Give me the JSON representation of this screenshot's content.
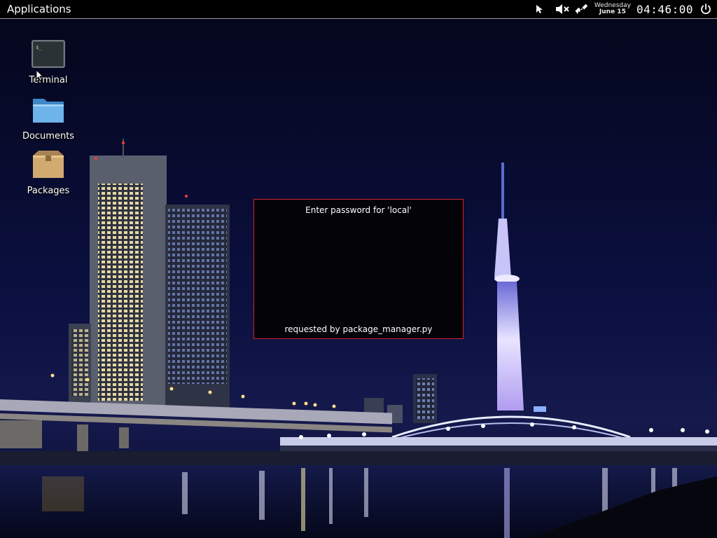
{
  "panel": {
    "applications_label": "Applications",
    "date_weekday": "Wednesday",
    "date_day": "June 15",
    "clock": "04:46:00",
    "tray_icons": [
      "pointer-icon",
      "volume-muted-icon",
      "network-disconnected-icon",
      "power-icon"
    ]
  },
  "desktop": {
    "icons": [
      {
        "label": "Terminal",
        "icon": "terminal-icon"
      },
      {
        "label": "Documents",
        "icon": "folder-icon"
      },
      {
        "label": "Packages",
        "icon": "package-box-icon"
      }
    ]
  },
  "dialog": {
    "prompt": "Enter password for 'local'",
    "requester": "requested by package_manager.py",
    "border_color": "#d4222a"
  },
  "colors": {
    "panel_bg": "#000000",
    "desktop_sky": "#06081f"
  }
}
